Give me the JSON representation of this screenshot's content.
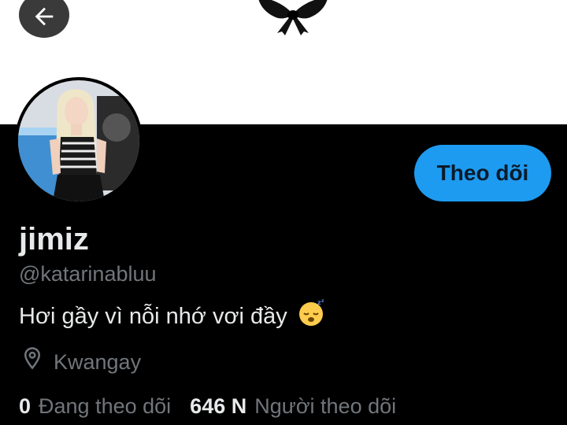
{
  "header": {
    "back_icon": "arrow-left-icon",
    "banner_decoration": "black-ribbon-bow"
  },
  "profile": {
    "display_name": "jimiz",
    "handle": "@katarinabluu",
    "bio_text": "Hơi gầy vì nỗi nhớ vơi đầy",
    "bio_emoji": "😴",
    "location_icon": "location-pin-icon",
    "location": "Kwangay"
  },
  "actions": {
    "follow_label": "Theo dõi"
  },
  "stats": {
    "following_count": "0",
    "following_label": "Đang theo dõi",
    "followers_count": "646 N",
    "followers_label": "Người theo dõi"
  },
  "colors": {
    "accent": "#1d9bf0",
    "background": "#000000",
    "banner": "#ffffff",
    "primary_text": "#e7e9ea",
    "secondary_text": "#71767b"
  }
}
